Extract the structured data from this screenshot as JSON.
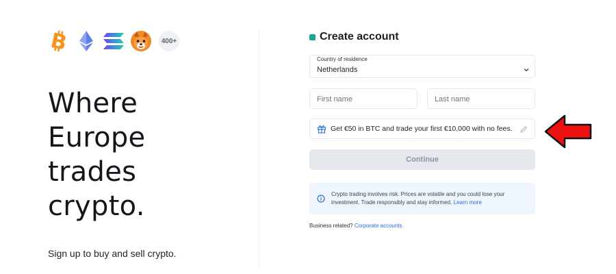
{
  "left": {
    "coins": [
      "bitcoin-icon",
      "ethereum-icon",
      "solana-icon",
      "shiba-inu-icon"
    ],
    "more_count": "400+",
    "headline": [
      "Where",
      "Europe",
      "trades",
      "crypto."
    ],
    "subline": "Sign up to buy and sell crypto."
  },
  "form": {
    "title": "Create account",
    "country": {
      "label": "Country of residence",
      "value": "Netherlands"
    },
    "first_name_placeholder": "First name",
    "last_name_placeholder": "Last name",
    "promo_text": "Get €50 in BTC and trade your first €10,000 with no fees.",
    "continue_label": "Continue",
    "notice_text": "Crypto trading involves risk. Prices are volatile and you could lose your investment. Trade responsibly and stay informed.",
    "notice_link": "Learn more",
    "business_text": "Business related?",
    "business_link": "Corporate accounts"
  },
  "colors": {
    "accent_link": "#2a6fd6",
    "button_disabled": "#e5e8ed",
    "notice_bg": "#eef5fd",
    "arrow_red": "#ee1111",
    "bitcoin": "#f7931a",
    "ethereum": "#627eea",
    "title_icon": "#1aa39a"
  }
}
